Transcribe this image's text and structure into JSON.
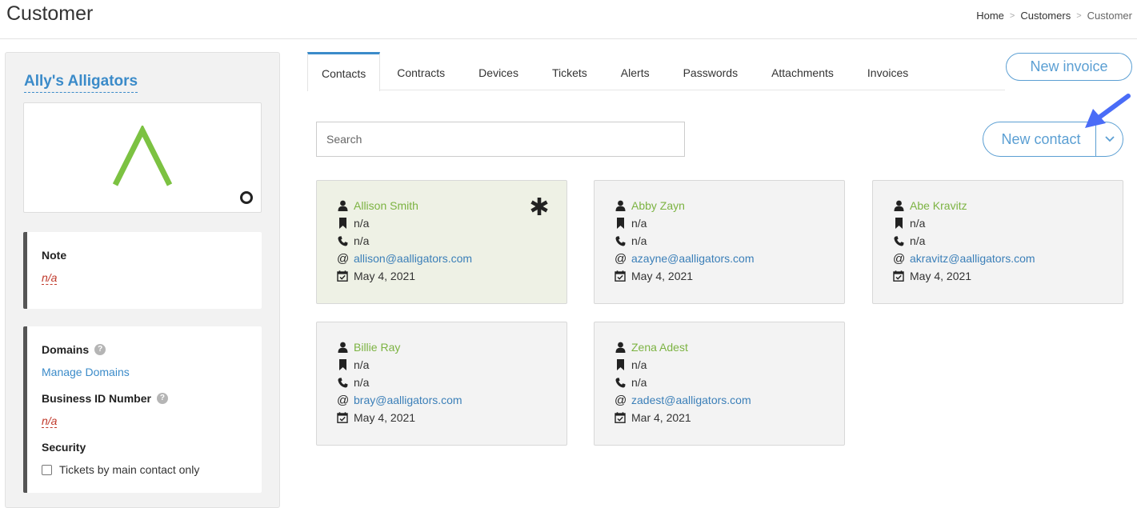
{
  "header": {
    "title": "Customer",
    "breadcrumb": [
      "Home",
      "Customers",
      "Customer"
    ]
  },
  "sidebar": {
    "company_name": "Ally's Alligators",
    "note": {
      "label": "Note",
      "value": "n/a"
    },
    "domains": {
      "label": "Domains",
      "link": "Manage Domains"
    },
    "business_id": {
      "label": "Business ID Number",
      "value": "n/a"
    },
    "security": {
      "label": "Security",
      "checkbox_label": "Tickets by main contact only"
    }
  },
  "tabs": [
    {
      "label": "Contacts",
      "active": true
    },
    {
      "label": "Contracts"
    },
    {
      "label": "Devices"
    },
    {
      "label": "Tickets"
    },
    {
      "label": "Alerts"
    },
    {
      "label": "Passwords"
    },
    {
      "label": "Attachments"
    },
    {
      "label": "Invoices"
    }
  ],
  "actions": {
    "new_invoice": "New invoice",
    "new_contact": "New contact"
  },
  "search": {
    "placeholder": "Search",
    "value": ""
  },
  "contacts": [
    {
      "name": "Allison Smith",
      "title": "n/a",
      "phone": "n/a",
      "email": "allison@aalligators.com",
      "date": "May 4, 2021",
      "primary": true
    },
    {
      "name": "Abby Zayn",
      "title": "n/a",
      "phone": "n/a",
      "email": "azayne@aalligators.com",
      "date": "May 4, 2021"
    },
    {
      "name": "Abe Kravitz",
      "title": "n/a",
      "phone": "n/a",
      "email": "akravitz@aalligators.com",
      "date": "May 4, 2021"
    },
    {
      "name": "Billie Ray",
      "title": "n/a",
      "phone": "n/a",
      "email": "bray@aalligators.com",
      "date": "May 4, 2021"
    },
    {
      "name": "Zena Adest",
      "title": "n/a",
      "phone": "n/a",
      "email": "zadest@aalligators.com",
      "date": "Mar 4, 2021"
    }
  ],
  "icons": {
    "contact_name": "user-icon",
    "contact_title": "bookmark-icon",
    "contact_phone": "phone-icon",
    "contact_email": "at-icon",
    "contact_date": "calendar-check-icon",
    "primary_marker": "asterisk-icon",
    "help": "help-icon",
    "annotation": "arrow-icon"
  },
  "colors": {
    "accent": "#3b8bc9",
    "contact_name": "#7cb342",
    "empty_value": "#c0392b",
    "primary_card": "#eef1e5",
    "logo": "#7cc242",
    "annotation_arrow": "#4a6cf7"
  }
}
